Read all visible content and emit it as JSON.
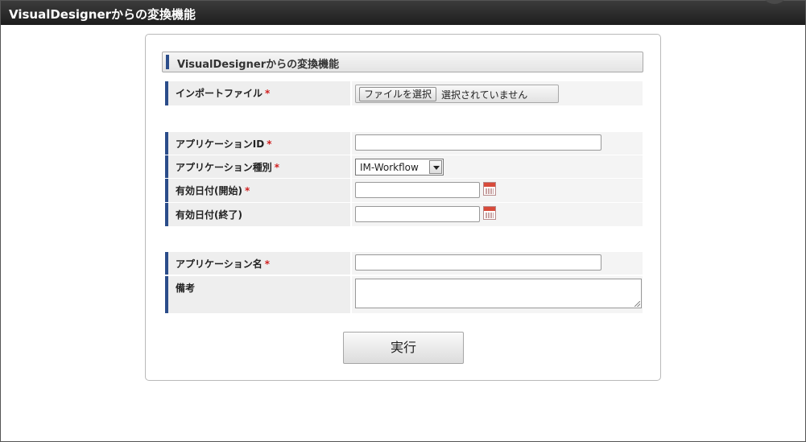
{
  "window": {
    "title": "VisualDesignerからの変換機能"
  },
  "section": {
    "title": "VisualDesignerからの変換機能"
  },
  "required_mark": "*",
  "fields": {
    "import_file": {
      "label": "インポートファイル",
      "button_label": "ファイルを選択",
      "status": "選択されていません"
    },
    "app_id": {
      "label": "アプリケーションID",
      "value": ""
    },
    "app_type": {
      "label": "アプリケーション種別",
      "selected": "IM-Workflow"
    },
    "start_date": {
      "label": "有効日付(開始)",
      "value": ""
    },
    "end_date": {
      "label": "有効日付(終了)",
      "value": ""
    },
    "app_name": {
      "label": "アプリケーション名",
      "value": ""
    },
    "remarks": {
      "label": "備考",
      "value": ""
    }
  },
  "actions": {
    "execute_label": "実行"
  },
  "icons": {
    "calendar": "calendar-icon",
    "dropdown": "chevron-down-icon"
  },
  "colors": {
    "accent": "#2b4d8a",
    "required": "#d02020",
    "titlebar": "#2a2a2a"
  }
}
